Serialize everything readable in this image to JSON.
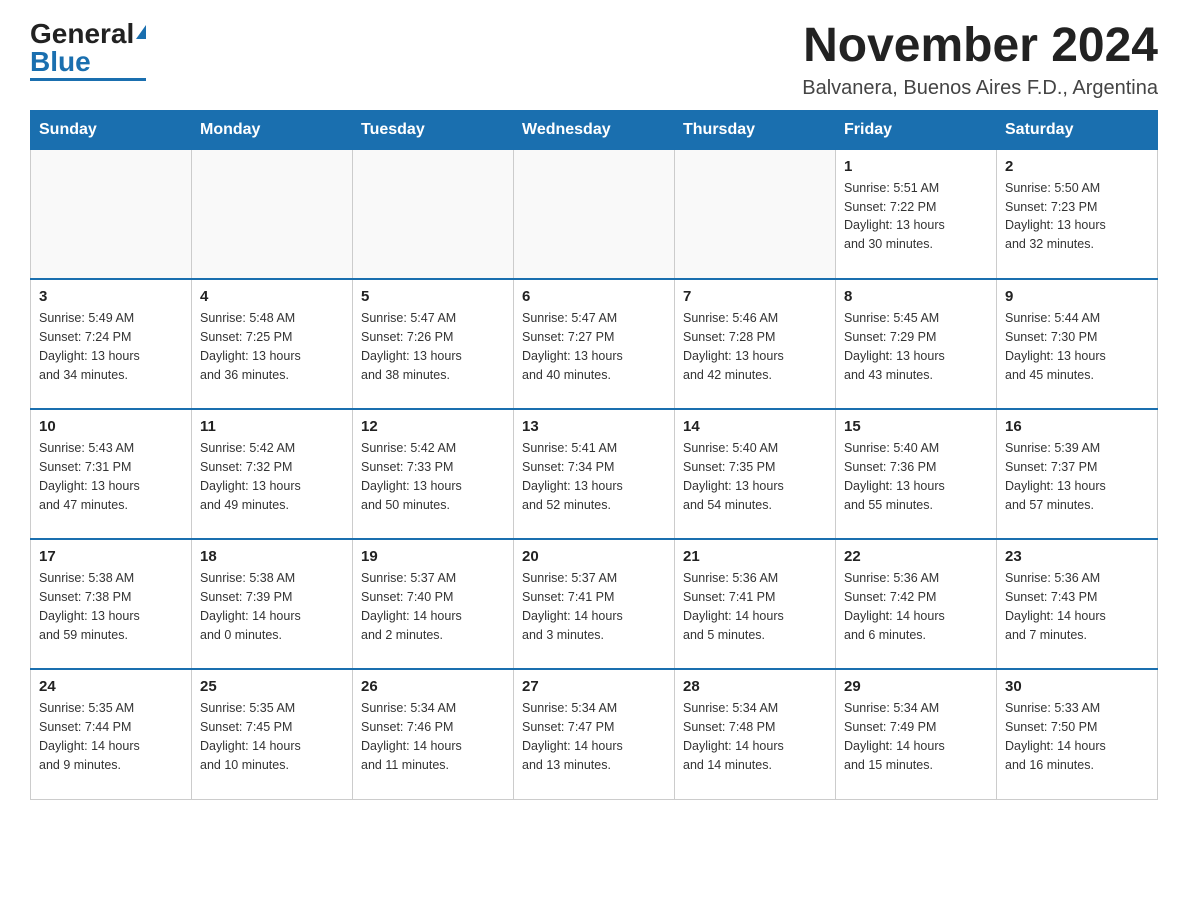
{
  "header": {
    "logo_general": "General",
    "logo_blue": "Blue",
    "month_title": "November 2024",
    "location": "Balvanera, Buenos Aires F.D., Argentina"
  },
  "weekdays": [
    "Sunday",
    "Monday",
    "Tuesday",
    "Wednesday",
    "Thursday",
    "Friday",
    "Saturday"
  ],
  "weeks": [
    [
      {
        "day": "",
        "info": ""
      },
      {
        "day": "",
        "info": ""
      },
      {
        "day": "",
        "info": ""
      },
      {
        "day": "",
        "info": ""
      },
      {
        "day": "",
        "info": ""
      },
      {
        "day": "1",
        "info": "Sunrise: 5:51 AM\nSunset: 7:22 PM\nDaylight: 13 hours\nand 30 minutes."
      },
      {
        "day": "2",
        "info": "Sunrise: 5:50 AM\nSunset: 7:23 PM\nDaylight: 13 hours\nand 32 minutes."
      }
    ],
    [
      {
        "day": "3",
        "info": "Sunrise: 5:49 AM\nSunset: 7:24 PM\nDaylight: 13 hours\nand 34 minutes."
      },
      {
        "day": "4",
        "info": "Sunrise: 5:48 AM\nSunset: 7:25 PM\nDaylight: 13 hours\nand 36 minutes."
      },
      {
        "day": "5",
        "info": "Sunrise: 5:47 AM\nSunset: 7:26 PM\nDaylight: 13 hours\nand 38 minutes."
      },
      {
        "day": "6",
        "info": "Sunrise: 5:47 AM\nSunset: 7:27 PM\nDaylight: 13 hours\nand 40 minutes."
      },
      {
        "day": "7",
        "info": "Sunrise: 5:46 AM\nSunset: 7:28 PM\nDaylight: 13 hours\nand 42 minutes."
      },
      {
        "day": "8",
        "info": "Sunrise: 5:45 AM\nSunset: 7:29 PM\nDaylight: 13 hours\nand 43 minutes."
      },
      {
        "day": "9",
        "info": "Sunrise: 5:44 AM\nSunset: 7:30 PM\nDaylight: 13 hours\nand 45 minutes."
      }
    ],
    [
      {
        "day": "10",
        "info": "Sunrise: 5:43 AM\nSunset: 7:31 PM\nDaylight: 13 hours\nand 47 minutes."
      },
      {
        "day": "11",
        "info": "Sunrise: 5:42 AM\nSunset: 7:32 PM\nDaylight: 13 hours\nand 49 minutes."
      },
      {
        "day": "12",
        "info": "Sunrise: 5:42 AM\nSunset: 7:33 PM\nDaylight: 13 hours\nand 50 minutes."
      },
      {
        "day": "13",
        "info": "Sunrise: 5:41 AM\nSunset: 7:34 PM\nDaylight: 13 hours\nand 52 minutes."
      },
      {
        "day": "14",
        "info": "Sunrise: 5:40 AM\nSunset: 7:35 PM\nDaylight: 13 hours\nand 54 minutes."
      },
      {
        "day": "15",
        "info": "Sunrise: 5:40 AM\nSunset: 7:36 PM\nDaylight: 13 hours\nand 55 minutes."
      },
      {
        "day": "16",
        "info": "Sunrise: 5:39 AM\nSunset: 7:37 PM\nDaylight: 13 hours\nand 57 minutes."
      }
    ],
    [
      {
        "day": "17",
        "info": "Sunrise: 5:38 AM\nSunset: 7:38 PM\nDaylight: 13 hours\nand 59 minutes."
      },
      {
        "day": "18",
        "info": "Sunrise: 5:38 AM\nSunset: 7:39 PM\nDaylight: 14 hours\nand 0 minutes."
      },
      {
        "day": "19",
        "info": "Sunrise: 5:37 AM\nSunset: 7:40 PM\nDaylight: 14 hours\nand 2 minutes."
      },
      {
        "day": "20",
        "info": "Sunrise: 5:37 AM\nSunset: 7:41 PM\nDaylight: 14 hours\nand 3 minutes."
      },
      {
        "day": "21",
        "info": "Sunrise: 5:36 AM\nSunset: 7:41 PM\nDaylight: 14 hours\nand 5 minutes."
      },
      {
        "day": "22",
        "info": "Sunrise: 5:36 AM\nSunset: 7:42 PM\nDaylight: 14 hours\nand 6 minutes."
      },
      {
        "day": "23",
        "info": "Sunrise: 5:36 AM\nSunset: 7:43 PM\nDaylight: 14 hours\nand 7 minutes."
      }
    ],
    [
      {
        "day": "24",
        "info": "Sunrise: 5:35 AM\nSunset: 7:44 PM\nDaylight: 14 hours\nand 9 minutes."
      },
      {
        "day": "25",
        "info": "Sunrise: 5:35 AM\nSunset: 7:45 PM\nDaylight: 14 hours\nand 10 minutes."
      },
      {
        "day": "26",
        "info": "Sunrise: 5:34 AM\nSunset: 7:46 PM\nDaylight: 14 hours\nand 11 minutes."
      },
      {
        "day": "27",
        "info": "Sunrise: 5:34 AM\nSunset: 7:47 PM\nDaylight: 14 hours\nand 13 minutes."
      },
      {
        "day": "28",
        "info": "Sunrise: 5:34 AM\nSunset: 7:48 PM\nDaylight: 14 hours\nand 14 minutes."
      },
      {
        "day": "29",
        "info": "Sunrise: 5:34 AM\nSunset: 7:49 PM\nDaylight: 14 hours\nand 15 minutes."
      },
      {
        "day": "30",
        "info": "Sunrise: 5:33 AM\nSunset: 7:50 PM\nDaylight: 14 hours\nand 16 minutes."
      }
    ]
  ]
}
